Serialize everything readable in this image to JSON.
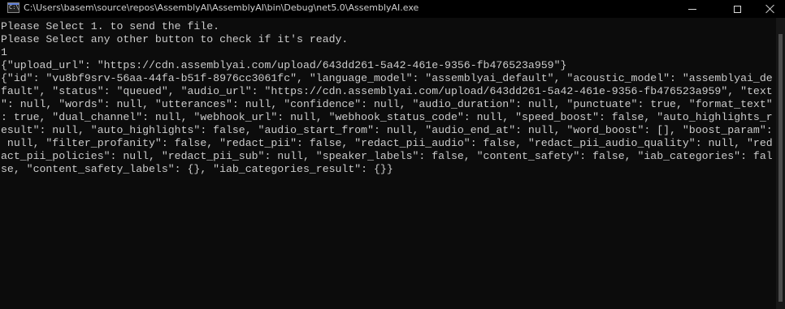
{
  "window": {
    "title": "C:\\Users\\basem\\source\\repos\\AssemblyAI\\AssemblyAI\\bin\\Debug\\net5.0\\AssemblyAI.exe",
    "icon_name": "console-app-icon",
    "icon_text": "C:\\"
  },
  "console": {
    "lines": [
      "Please Select 1. to send the file.",
      "Please Select any other button to check if it's ready.",
      "1",
      "{\"upload_url\": \"https://cdn.assemblyai.com/upload/643dd261-5a42-461e-9356-fb476523a959\"}",
      "{\"id\": \"vu8bf9srv-56aa-44fa-b51f-8976cc3061fc\", \"language_model\": \"assemblyai_default\", \"acoustic_model\": \"assemblyai_de",
      "fault\", \"status\": \"queued\", \"audio_url\": \"https://cdn.assemblyai.com/upload/643dd261-5a42-461e-9356-fb476523a959\", \"text",
      "\": null, \"words\": null, \"utterances\": null, \"confidence\": null, \"audio_duration\": null, \"punctuate\": true, \"format_text\"",
      ": true, \"dual_channel\": null, \"webhook_url\": null, \"webhook_status_code\": null, \"speed_boost\": false, \"auto_highlights_r",
      "esult\": null, \"auto_highlights\": false, \"audio_start_from\": null, \"audio_end_at\": null, \"word_boost\": [], \"boost_param\":",
      " null, \"filter_profanity\": false, \"redact_pii\": false, \"redact_pii_audio\": false, \"redact_pii_audio_quality\": null, \"red",
      "act_pii_policies\": null, \"redact_pii_sub\": null, \"speaker_labels\": false, \"content_safety\": false, \"iab_categories\": fal",
      "se, \"content_safety_labels\": {}, \"iab_categories_result\": {}}"
    ]
  },
  "colors": {
    "background": "#0c0c0c",
    "titlebar": "#000000",
    "text": "#cccccc"
  }
}
